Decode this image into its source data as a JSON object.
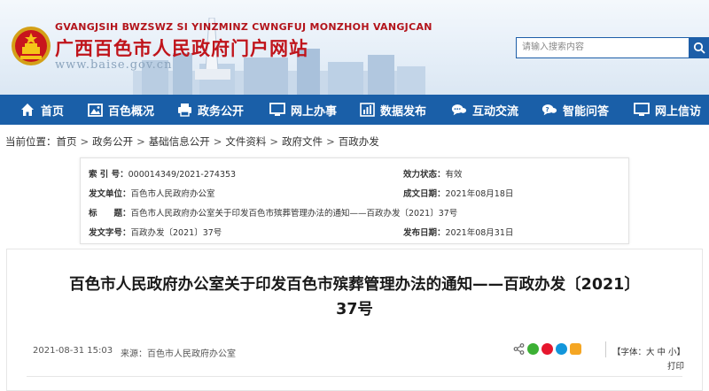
{
  "header": {
    "site_name_en": "GVANGJSIH BWZSWZ SI YINZMINZ CWNGFUJ MONZHOH VANGJCAN",
    "site_name_cn": "广西百色市人民政府门户网站",
    "site_url": "www.baise.gov.cn",
    "search_placeholder": "请输入搜索内容",
    "brand_color": "#1a5fa8",
    "title_color": "#c0141b"
  },
  "nav": {
    "items": [
      {
        "label": "首页",
        "icon": "home-icon"
      },
      {
        "label": "百色概况",
        "icon": "image-icon"
      },
      {
        "label": "政务公开",
        "icon": "print-icon"
      },
      {
        "label": "网上办事",
        "icon": "monitor-icon"
      },
      {
        "label": "数据发布",
        "icon": "bar-chart-icon"
      },
      {
        "label": "互动交流",
        "icon": "chat-icon"
      },
      {
        "label": "智能问答",
        "icon": "qa-icon"
      },
      {
        "label": "网上信访",
        "icon": "monitor-icon"
      }
    ]
  },
  "breadcrumb": {
    "prefix": "当前位置：",
    "items": [
      "首页",
      "政务公开",
      "基础信息公开",
      "文件资料",
      "政府文件",
      "百政办发"
    ],
    "separator": ">"
  },
  "meta": {
    "index_label": "索 引 号：",
    "index_value": "000014349/2021-274353",
    "status_label": "效力状态：",
    "status_value": "有效",
    "issuer_label": "发文单位：",
    "issuer_value": "百色市人民政府办公室",
    "date_label": "成文日期：",
    "date_value": "2021年08月18日",
    "title_label": "标　　题：",
    "title_value": "百色市人民政府办公室关于印发百色市殡葬管理办法的通知——百政办发〔2021〕37号",
    "docno_label": "发文字号：",
    "docno_value": "百政办发〔2021〕37号",
    "publish_label": "发布日期：",
    "publish_value": "2021年08月31日"
  },
  "article": {
    "title_line1": "百色市人民政府办公室关于印发百色市殡葬管理办法的通知——百政办发〔2021〕",
    "title_line2": "37号",
    "datetime": "2021-08-31 15:03",
    "source": "来源：百色市人民政府办公室",
    "fontsize_label": "【字体：大 中 小】",
    "print_label": "打印",
    "share_icons": [
      "share-icon",
      "wechat-icon",
      "weibo-icon",
      "qq-icon",
      "qzone-icon"
    ]
  }
}
